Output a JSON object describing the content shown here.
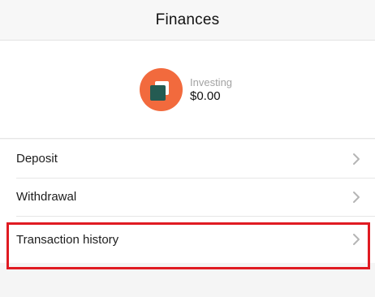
{
  "header": {
    "title": "Finances"
  },
  "account": {
    "label": "Investing",
    "value": "$0.00",
    "logo_icon": "square-overlap-logo-icon",
    "logo_color": "#f26a3d"
  },
  "menu": {
    "items": [
      {
        "label": "Deposit",
        "icon": "chevron-right-icon"
      },
      {
        "label": "Withdrawal",
        "icon": "chevron-right-icon"
      },
      {
        "label": "Transaction history",
        "icon": "chevron-right-icon",
        "highlighted": true
      }
    ]
  },
  "colors": {
    "highlight": "#e01b22",
    "accent": "#f26a3d",
    "chevron": "#b5b5b5"
  }
}
